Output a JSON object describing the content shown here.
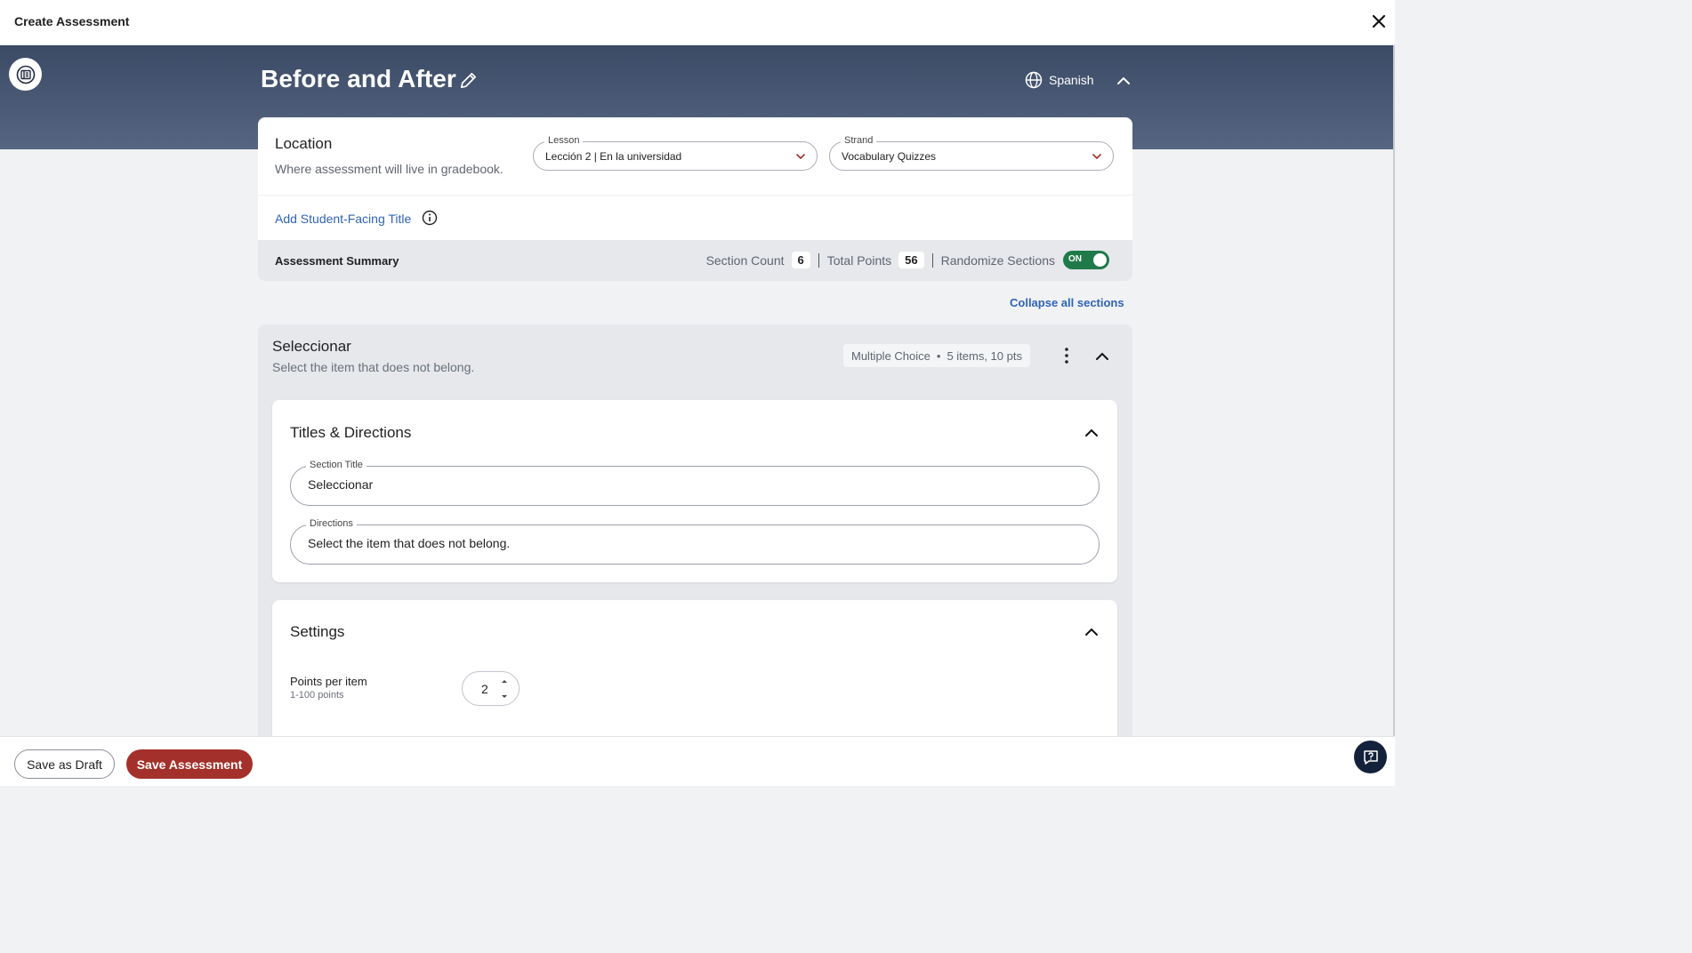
{
  "window": {
    "title": "Create Assessment"
  },
  "header": {
    "title": "Before and After",
    "language": "Spanish"
  },
  "location": {
    "title": "Location",
    "subtitle": "Where assessment will live in gradebook.",
    "lesson_label": "Lesson",
    "lesson_value": "Lección 2 | En la universidad",
    "strand_label": "Strand",
    "strand_value": "Vocabulary Quizzes",
    "add_title_link": "Add Student-Facing Title"
  },
  "summary": {
    "title": "Assessment Summary",
    "section_count_label": "Section Count",
    "section_count": "6",
    "total_points_label": "Total Points",
    "total_points": "56",
    "randomize_label": "Randomize Sections",
    "randomize_state": "ON"
  },
  "collapse_all": "Collapse all sections",
  "section": {
    "title": "Seleccionar",
    "subtitle": "Select the item that does not belong.",
    "type": "Multiple Choice",
    "meta": "5 items, 10 pts",
    "titles_directions": {
      "heading": "Titles & Directions",
      "section_title_label": "Section Title",
      "section_title_value": "Seleccionar",
      "directions_label": "Directions",
      "directions_value": "Select the item that does not belong."
    },
    "settings": {
      "heading": "Settings",
      "points_label": "Points per item",
      "points_range": "1-100 points",
      "points_value": "2"
    }
  },
  "footer": {
    "draft_label": "Save as Draft",
    "save_label": "Save Assessment"
  },
  "colors": {
    "accent_link": "#2f63b4",
    "save_button": "#a3302a",
    "toggle_on": "#1f7a4a",
    "header_band": "#3b4a65"
  },
  "icons": [
    "close-icon",
    "sidebar-toggle-icon",
    "pencil-icon",
    "globe-icon",
    "chevron-up-icon",
    "chevron-down-icon",
    "info-icon",
    "kebab-menu-icon",
    "help-icon"
  ]
}
